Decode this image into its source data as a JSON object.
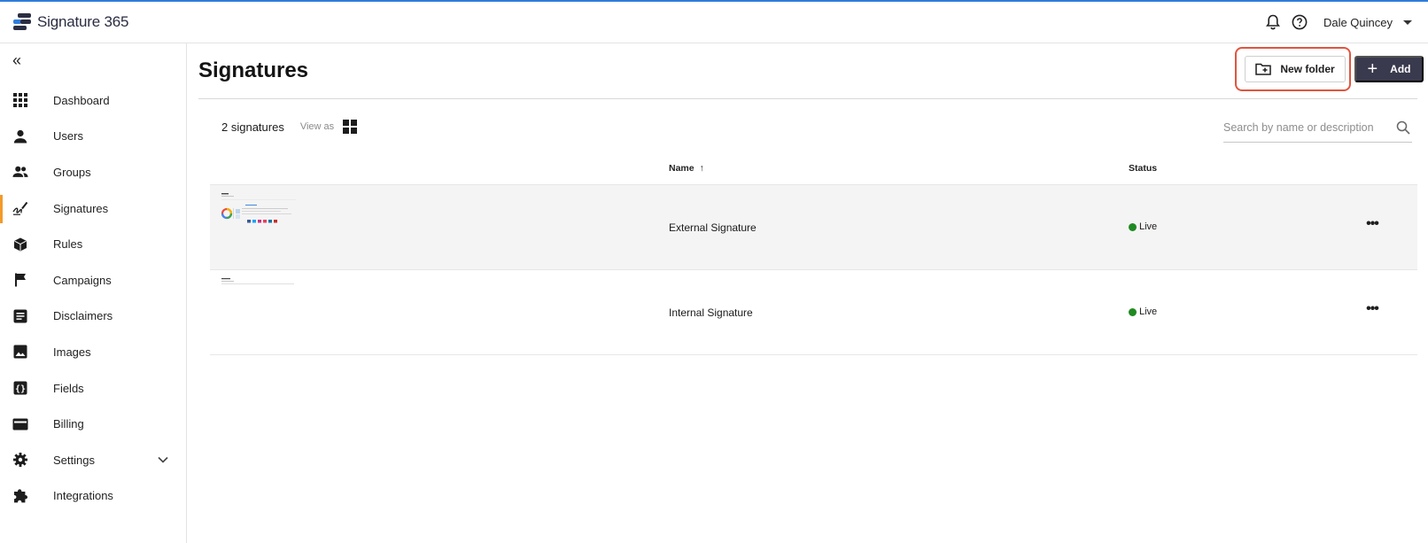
{
  "app": {
    "name": "Signature 365",
    "brand_colors": [
      "#2b2d42",
      "#2f7ddb"
    ]
  },
  "topbar": {
    "user_name": "Dale Quincey",
    "icons": [
      "bell-icon",
      "help-icon",
      "chevron-down-icon"
    ]
  },
  "sidebar": {
    "active": "Signatures",
    "accent_color": "#f39a2b",
    "items": [
      {
        "label": "Dashboard",
        "icon": "dashboard-grid-icon"
      },
      {
        "label": "Users",
        "icon": "user-icon"
      },
      {
        "label": "Groups",
        "icon": "groups-icon"
      },
      {
        "label": "Signatures",
        "icon": "signature-pen-icon"
      },
      {
        "label": "Rules",
        "icon": "cube-icon"
      },
      {
        "label": "Campaigns",
        "icon": "flag-icon"
      },
      {
        "label": "Disclaimers",
        "icon": "document-icon"
      },
      {
        "label": "Images",
        "icon": "image-icon"
      },
      {
        "label": "Fields",
        "icon": "braces-icon"
      },
      {
        "label": "Billing",
        "icon": "credit-card-icon"
      },
      {
        "label": "Settings",
        "icon": "gear-icon"
      },
      {
        "label": "Integrations",
        "icon": "puzzle-icon"
      }
    ]
  },
  "page": {
    "title": "Signatures",
    "new_folder_label": "New folder",
    "add_label": "Add",
    "add_button_color": "#3a3a4e",
    "highlight_color": "#e0553f"
  },
  "list": {
    "count_label": "2 signatures",
    "view_as_label": "View as",
    "search_placeholder": "Search by name or description",
    "columns": {
      "name": "Name",
      "sort_icon": "↑",
      "status": "Status"
    },
    "rows": [
      {
        "name": "External Signature",
        "status": "Live",
        "status_color": "#1f8a21",
        "thumbnail": "external-signature-preview"
      },
      {
        "name": "Internal Signature",
        "status": "Live",
        "status_color": "#1f8a21",
        "thumbnail": "internal-signature-preview"
      }
    ],
    "row_actions_icon": "more-horizontal-icon"
  }
}
